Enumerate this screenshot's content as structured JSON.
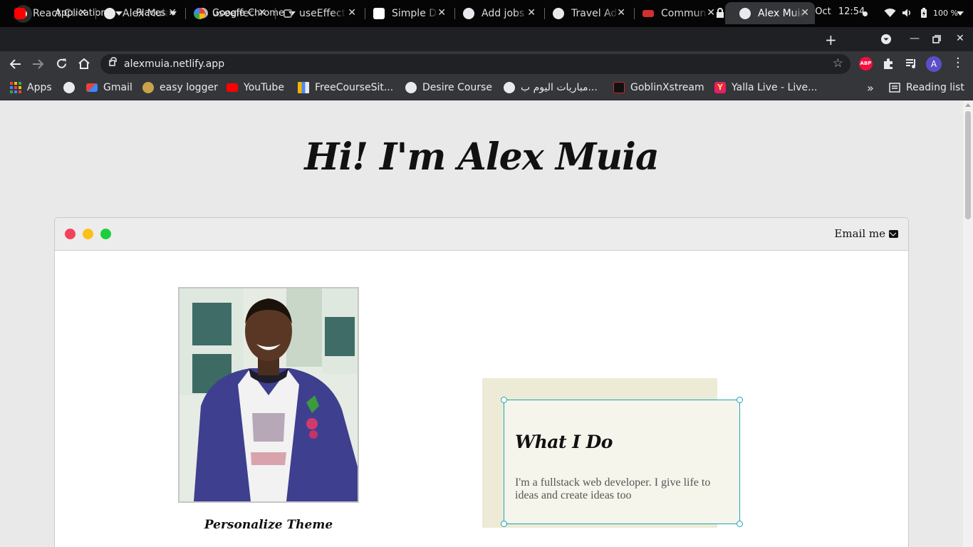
{
  "system_bar": {
    "applications": "Applications",
    "places": "Places",
    "app_name": "Google Chrome",
    "date": "Thu 21 Oct",
    "time": "12:54",
    "battery": "100 %"
  },
  "tabs": [
    {
      "title": "React Cus",
      "favicon": "youtube-icon",
      "color": "#ff0000"
    },
    {
      "title": "Alex Muia",
      "favicon": "globe-icon",
      "color": "#e8eaed"
    },
    {
      "title": "useeffect",
      "favicon": "google-icon",
      "color": "#4285f4"
    },
    {
      "title": "useEffect",
      "favicon": "cube-icon",
      "color": "#9aa0a6"
    },
    {
      "title": "Simple D",
      "favicon": "medium-icon",
      "color": "#ffffff"
    },
    {
      "title": "Add jobs",
      "favicon": "globe-icon",
      "color": "#e8eaed"
    },
    {
      "title": "Travel Ad",
      "favicon": "globe-icon",
      "color": "#e8eaed"
    },
    {
      "title": "Commun",
      "favicon": "heart-icon",
      "color": "#d32f2f"
    },
    {
      "title": "Alex Muia",
      "favicon": "globe-icon",
      "color": "#e8eaed",
      "active": true
    }
  ],
  "address_bar": {
    "url": "alexmuia.netlify.app"
  },
  "bookmarks": [
    {
      "label": "Apps",
      "icon": "apps-grid-icon"
    },
    {
      "label": "",
      "icon": "globe-icon"
    },
    {
      "label": "Gmail",
      "icon": "gmail-icon"
    },
    {
      "label": "easy logger",
      "icon": "logger-icon"
    },
    {
      "label": "YouTube",
      "icon": "youtube-icon"
    },
    {
      "label": "FreeCourseSit...",
      "icon": "course-icon"
    },
    {
      "label": "Desire Course",
      "icon": "globe-icon"
    },
    {
      "label": "مباريات اليوم ب...",
      "icon": "globe-icon"
    },
    {
      "label": "GoblinXstream",
      "icon": "goblin-icon"
    },
    {
      "label": "Yalla Live - Live...",
      "icon": "yalla-icon"
    }
  ],
  "reading_list": "Reading list",
  "more_bookmarks": "»",
  "page": {
    "hero_title": "Hi! I'm Alex Muia",
    "email_label": "Email me",
    "theme_label": "Personalize Theme",
    "card": {
      "title": "What I Do",
      "text": "I'm a fullstack web developer. I give life to ideas and create ideas too"
    }
  },
  "colors": {
    "dot_red": "#f4425a",
    "dot_yellow": "#f9c11a",
    "dot_green": "#1bcf3c",
    "accent": "#1ba5b5",
    "card_back": "#edebd6"
  }
}
